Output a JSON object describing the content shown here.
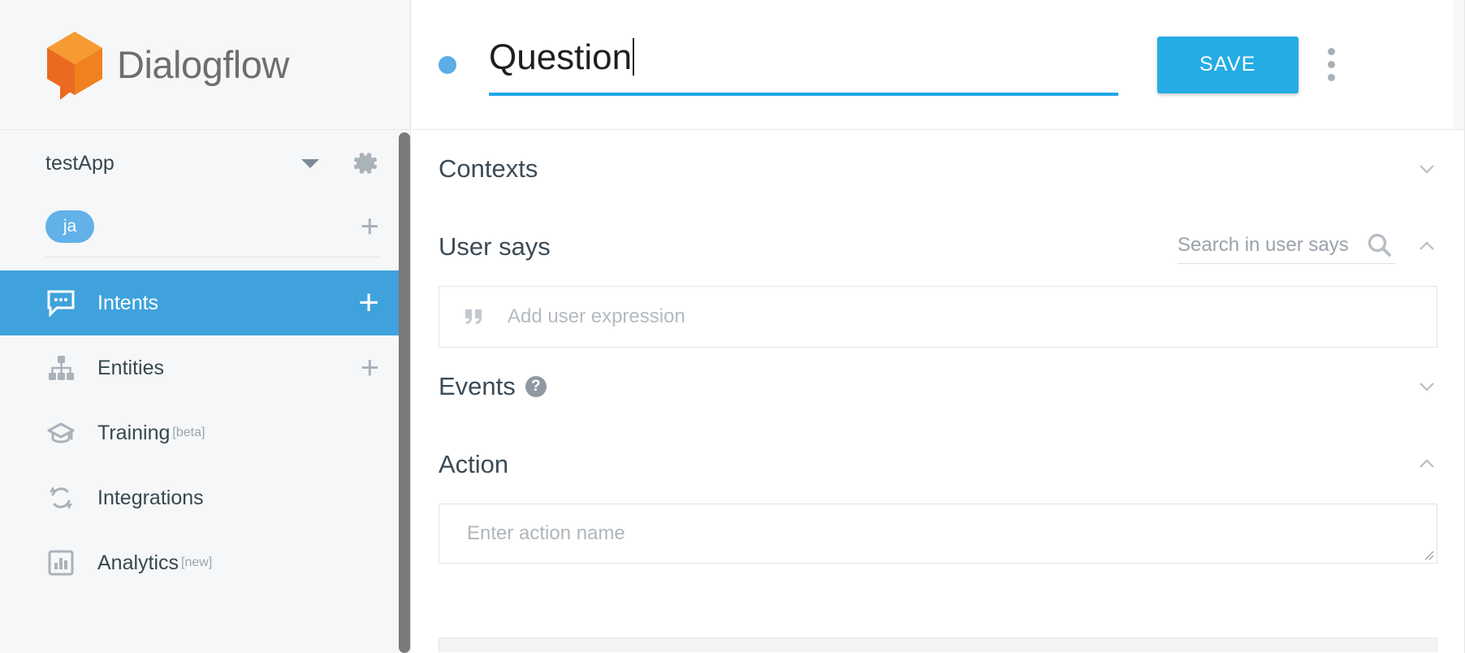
{
  "brand": {
    "name": "Dialogflow",
    "logo_icon": "dialogflow-cube-logo",
    "logo_colors": {
      "light": "#f79a32",
      "mid": "#f58220",
      "dark": "#ea6b1f"
    }
  },
  "sidebar": {
    "agent": {
      "name": "testApp",
      "dropdown_icon": "caret-down-icon",
      "settings_icon": "gear-icon"
    },
    "languages": {
      "chips": [
        {
          "code": "ja"
        }
      ],
      "add_icon": "plus-icon"
    },
    "nav_items": [
      {
        "label": "Intents",
        "icon": "chat-bubble-icon",
        "active": true,
        "add_icon": "plus-icon"
      },
      {
        "label": "Entities",
        "icon": "sitemap-icon",
        "active": false,
        "add_icon": "plus-icon"
      },
      {
        "label": "Training",
        "icon": "graduation-cap-icon",
        "active": false,
        "badge": "[beta]"
      },
      {
        "label": "Integrations",
        "icon": "sync-arrows-icon",
        "active": false
      },
      {
        "label": "Analytics",
        "icon": "bar-chart-icon",
        "active": false,
        "badge": "[new]"
      }
    ],
    "scrollbar": {
      "name": "sidebar-scrollbar",
      "thumb_color": "#7a7a7a"
    }
  },
  "header": {
    "status_dot_color": "#5dade8",
    "intent_title": "Question",
    "intent_title_underline_color": "#20a6ea",
    "save_label": "SAVE",
    "save_color": "#25ace4",
    "overflow_icon": "kebab-vertical-icon"
  },
  "main": {
    "sections": [
      {
        "title": "Contexts",
        "collapsed": true,
        "chevron": "chevron-down-icon"
      },
      {
        "title": "User says",
        "collapsed": false,
        "chevron": "chevron-up-icon",
        "search_placeholder": "Search in user says",
        "search_icon": "search-icon",
        "expression_placeholder": "Add user expression",
        "expression_icon": "quote-icon"
      },
      {
        "title": "Events",
        "collapsed": true,
        "chevron": "chevron-down-icon",
        "help_icon": "help-circle-icon",
        "help_label": "?"
      },
      {
        "title": "Action",
        "collapsed": false,
        "chevron": "chevron-up-icon",
        "action_placeholder": "Enter action name",
        "resize_icon": "resize-grip-icon"
      }
    ]
  }
}
